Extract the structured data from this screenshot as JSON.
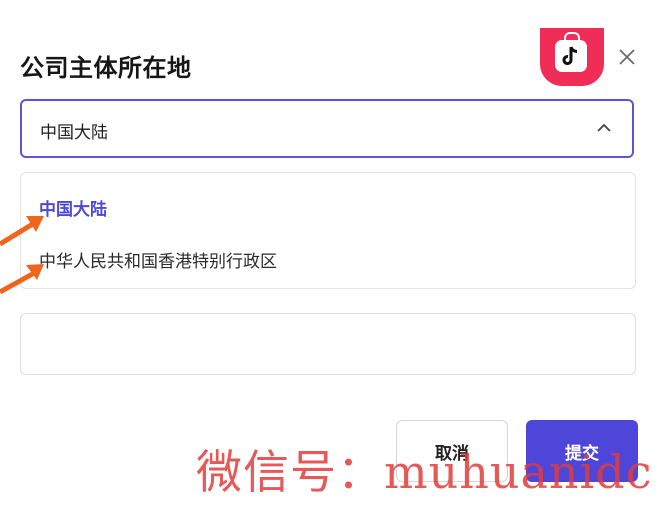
{
  "dialog": {
    "title": "公司主体所在地"
  },
  "region_select": {
    "selected_value": "中国大陆",
    "options": [
      "中国大陆",
      "中华人民共和国香港特别行政区"
    ]
  },
  "second_field": {
    "value": "",
    "placeholder": ""
  },
  "actions": {
    "cancel_label": "取消",
    "submit_label": "提交"
  },
  "watermark": {
    "text": "微信号：muhuanidc"
  },
  "icons": {
    "logo": "tiktok-shop-logo",
    "close": "close-icon",
    "chevron": "chevron-up-icon",
    "annotation": "orange-arrow"
  },
  "colors": {
    "accent": "#4e47d8",
    "logo_bg": "#ef2d56",
    "annotation_arrow": "#f0641e",
    "watermark": "#e23c3c"
  }
}
